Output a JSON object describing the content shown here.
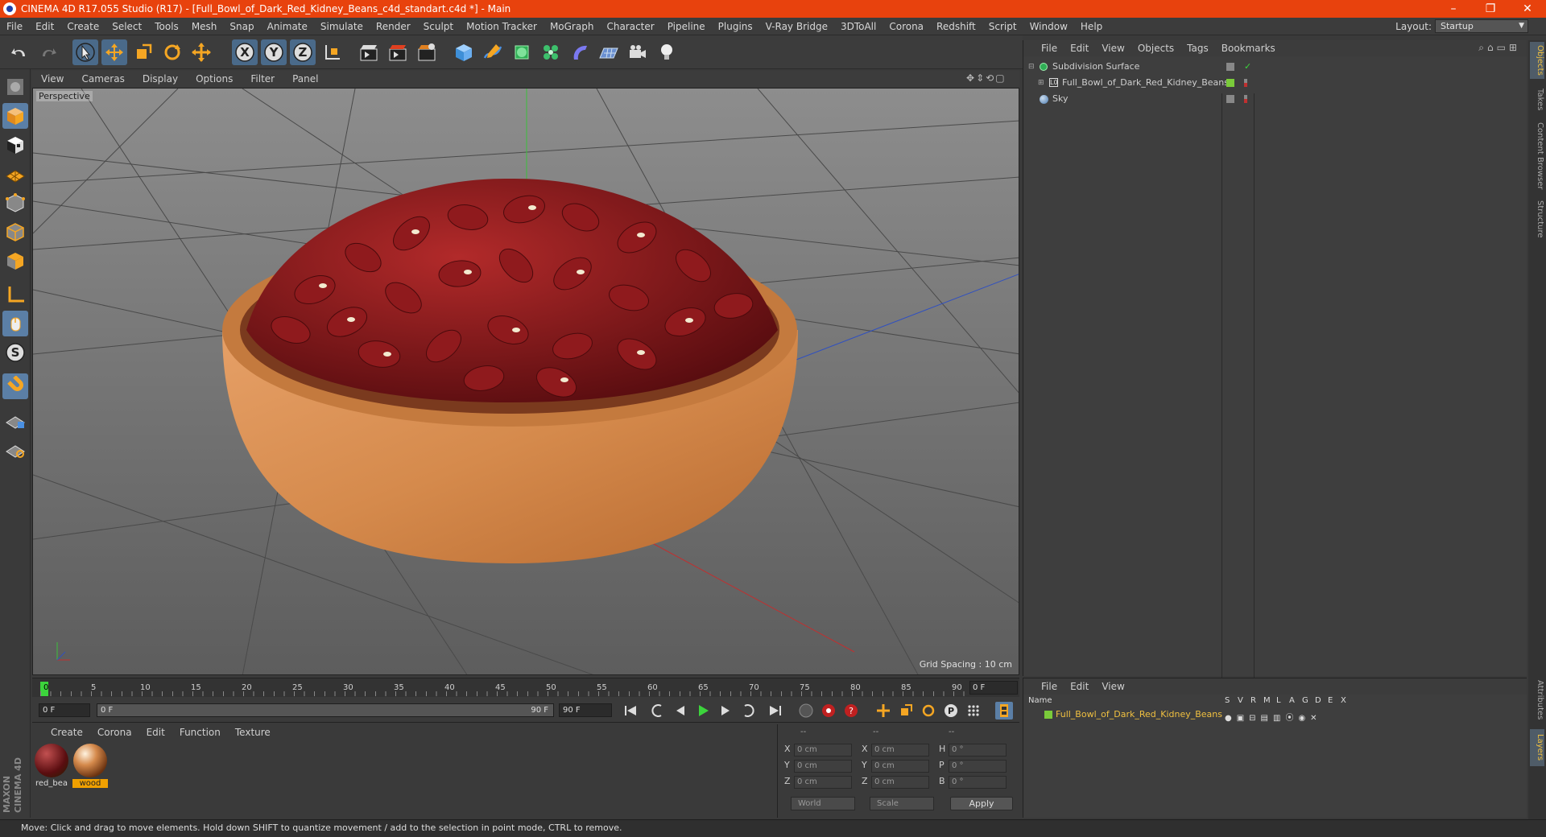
{
  "window": {
    "title": "CINEMA 4D R17.055 Studio (R17) - [Full_Bowl_of_Dark_Red_Kidney_Beans_c4d_standart.c4d *] - Main",
    "minimize": "–",
    "restore": "❐",
    "close": "✕"
  },
  "menu": [
    "File",
    "Edit",
    "Create",
    "Select",
    "Tools",
    "Mesh",
    "Snap",
    "Animate",
    "Simulate",
    "Render",
    "Sculpt",
    "Motion Tracker",
    "MoGraph",
    "Character",
    "Pipeline",
    "Plugins",
    "V-Ray Bridge",
    "3DToAll",
    "Corona",
    "Redshift",
    "Script",
    "Window",
    "Help"
  ],
  "layout": {
    "label": "Layout:",
    "value": "Startup"
  },
  "viewport": {
    "menu": [
      "View",
      "Cameras",
      "Display",
      "Options",
      "Filter",
      "Panel"
    ],
    "name": "Perspective",
    "grid_spacing": "Grid Spacing : 10 cm"
  },
  "timeline": {
    "ticks": [
      "0",
      "5",
      "10",
      "15",
      "20",
      "25",
      "30",
      "35",
      "40",
      "45",
      "50",
      "55",
      "60",
      "65",
      "70",
      "75",
      "80",
      "85",
      "90"
    ],
    "current_frame": "0 F",
    "start_field": "0 F",
    "range_start": "0 F",
    "range_end": "90 F",
    "end_field": "90 F"
  },
  "materials": {
    "menu": [
      "Create",
      "Corona",
      "Edit",
      "Function",
      "Texture"
    ],
    "items": [
      {
        "name": "red_bea"
      },
      {
        "name": "wood"
      }
    ]
  },
  "coordinates": {
    "header": [
      "--",
      "--",
      "--"
    ],
    "rows": [
      {
        "a": "X",
        "av": "0 cm",
        "b": "X",
        "bv": "0 cm",
        "c": "H",
        "cv": "0 °"
      },
      {
        "a": "Y",
        "av": "0 cm",
        "b": "Y",
        "bv": "0 cm",
        "c": "P",
        "cv": "0 °"
      },
      {
        "a": "Z",
        "av": "0 cm",
        "b": "Z",
        "bv": "0 cm",
        "c": "B",
        "cv": "0 °"
      }
    ],
    "world": "World",
    "scale": "Scale",
    "apply": "Apply"
  },
  "objects": {
    "menu": [
      "File",
      "Edit",
      "View",
      "Objects",
      "Tags",
      "Bookmarks"
    ],
    "items": [
      {
        "name": "Subdivision Surface"
      },
      {
        "name": "Full_Bowl_of_Dark_Red_Kidney_Beans"
      },
      {
        "name": "Sky"
      }
    ]
  },
  "layers": {
    "menu": [
      "File",
      "Edit",
      "View"
    ],
    "header_name": "Name",
    "header_cols": [
      "S",
      "V",
      "R",
      "M",
      "L",
      "A",
      "G",
      "D",
      "E",
      "X"
    ],
    "items": [
      {
        "name": "Full_Bowl_of_Dark_Red_Kidney_Beans"
      }
    ]
  },
  "right_tabs": [
    "Objects",
    "Takes",
    "Content Browser",
    "Structure",
    "Attributes",
    "Layers"
  ],
  "status": "Move: Click and drag to move elements. Hold down SHIFT to quantize movement / add to the selection in point mode, CTRL to remove.",
  "maxon": {
    "line1": "MAXON",
    "line2": "CINEMA 4D"
  },
  "colors": {
    "title_bar": "#e8420d",
    "selection": "#5b7fa6",
    "layer_color": "#7acb3a",
    "material_selected": "#f0a000"
  }
}
